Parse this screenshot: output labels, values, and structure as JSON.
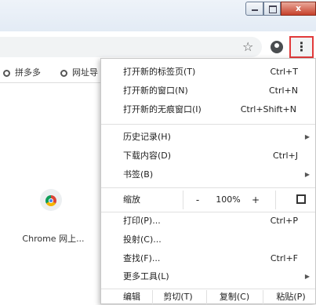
{
  "window": {
    "minimize_glyph": "",
    "maximize_glyph": "",
    "close_glyph": "x"
  },
  "toolbar": {
    "star_icon": "☆",
    "menu_icon": "⋮"
  },
  "bookmarks": [
    {
      "label": "拼多多",
      "icon": "globe-icon"
    },
    {
      "label": "网址导",
      "icon": "globe-icon"
    }
  ],
  "tile": {
    "label": "Chrome 网上..."
  },
  "menu": {
    "group1": [
      {
        "label": "打开新的标签页(T)",
        "shortcut": "Ctrl+T"
      },
      {
        "label": "打开新的窗口(N)",
        "shortcut": "Ctrl+N"
      },
      {
        "label": "打开新的无痕窗口(I)",
        "shortcut": "Ctrl+Shift+N"
      }
    ],
    "group2": [
      {
        "label": "历史记录(H)",
        "shortcut": "",
        "submenu": true
      },
      {
        "label": "下载内容(D)",
        "shortcut": "Ctrl+J",
        "submenu": false
      },
      {
        "label": "书签(B)",
        "shortcut": "",
        "submenu": true
      }
    ],
    "zoom": {
      "label": "缩放",
      "minus": "-",
      "value": "100%",
      "plus": "+"
    },
    "group3": [
      {
        "label": "打印(P)...",
        "shortcut": "Ctrl+P",
        "submenu": false
      },
      {
        "label": "投射(C)...",
        "shortcut": "",
        "submenu": false
      },
      {
        "label": "查找(F)...",
        "shortcut": "Ctrl+F",
        "submenu": false
      },
      {
        "label": "更多工具(L)",
        "shortcut": "",
        "submenu": true
      }
    ],
    "edit": {
      "label": "编辑",
      "cut": "剪切(T)",
      "copy": "复制(C)",
      "paste": "粘贴(P)"
    }
  }
}
